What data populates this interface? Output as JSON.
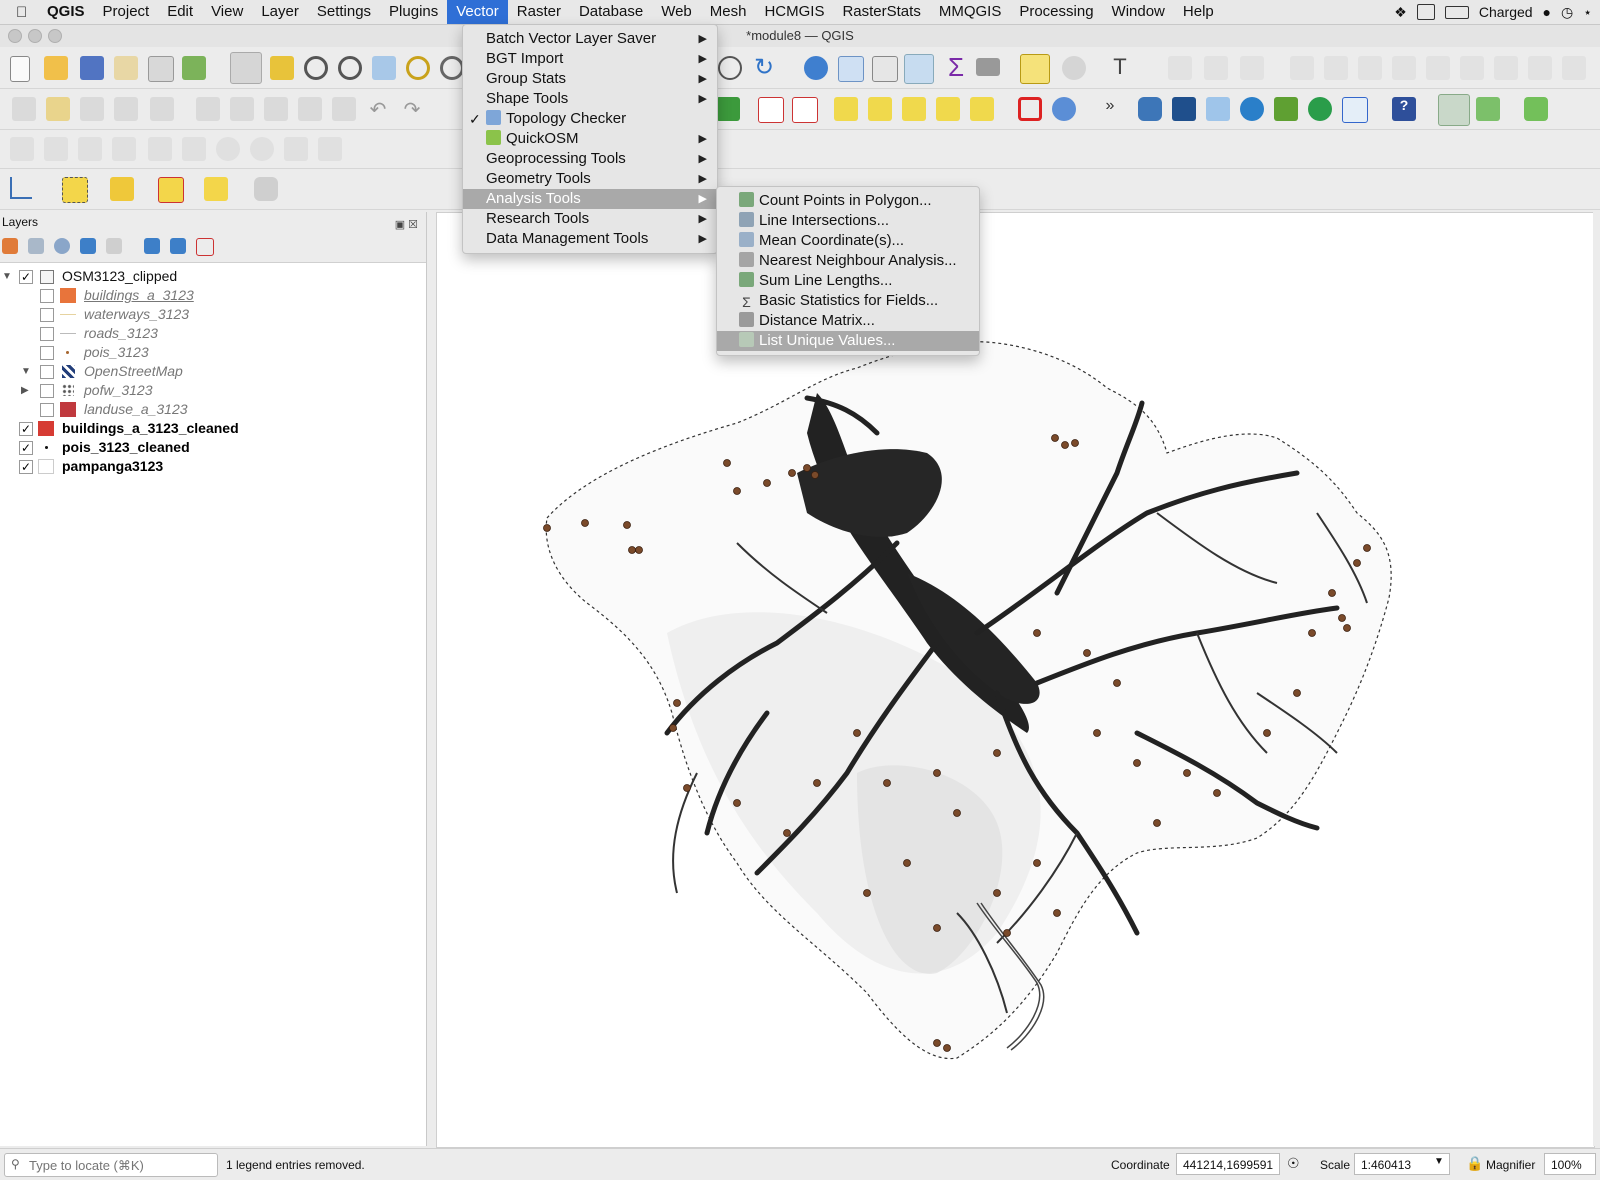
{
  "menubar": {
    "app": "QGIS",
    "items": [
      "Project",
      "Edit",
      "View",
      "Layer",
      "Settings",
      "Plugins",
      "Vector",
      "Raster",
      "Database",
      "Web",
      "Mesh",
      "HCMGIS",
      "RasterStats",
      "MMQGIS",
      "Processing",
      "Window",
      "Help"
    ],
    "active": "Vector",
    "battery": "Charged"
  },
  "window": {
    "title": "*module8 — QGIS"
  },
  "layers_panel": {
    "title": "Layers",
    "tree": [
      {
        "label": "OSM3123_clipped",
        "checked": true,
        "group": true,
        "expanded": true,
        "style": "normal"
      },
      {
        "label": "buildings_a_3123",
        "checked": false,
        "style": "off",
        "swatch": "#e8743b"
      },
      {
        "label": "waterways_3123",
        "checked": false,
        "style": "off",
        "swatch": "line-light"
      },
      {
        "label": "roads_3123",
        "checked": false,
        "style": "off",
        "swatch": "line-gray"
      },
      {
        "label": "pois_3123",
        "checked": false,
        "style": "off",
        "swatch": "dot"
      },
      {
        "label": "OpenStreetMap",
        "checked": false,
        "style": "off",
        "swatch": "osm",
        "expanded": true
      },
      {
        "label": "pofw_3123",
        "checked": false,
        "style": "off",
        "swatch": "points",
        "collapsed": true
      },
      {
        "label": "landuse_a_3123",
        "checked": false,
        "style": "off",
        "swatch": "#c0393e"
      },
      {
        "label": "buildings_a_3123_cleaned",
        "checked": true,
        "style": "on",
        "swatch": "#d63b33"
      },
      {
        "label": "pois_3123_cleaned",
        "checked": true,
        "style": "on",
        "swatch": "dot-black"
      },
      {
        "label": "pampanga3123",
        "checked": true,
        "style": "on",
        "swatch": "empty"
      }
    ]
  },
  "vector_menu": {
    "items": [
      {
        "label": "Batch Vector Layer Saver",
        "submenu": true
      },
      {
        "label": "BGT Import",
        "submenu": true
      },
      {
        "label": "Group Stats",
        "submenu": true
      },
      {
        "label": "Shape Tools",
        "submenu": true
      },
      {
        "label": "Topology Checker",
        "checked": true,
        "icon": true
      },
      {
        "label": "QuickOSM",
        "submenu": true,
        "icon": true
      },
      {
        "label": "Geoprocessing Tools",
        "submenu": true
      },
      {
        "label": "Geometry Tools",
        "submenu": true
      },
      {
        "label": "Analysis Tools",
        "submenu": true,
        "highlighted": true
      },
      {
        "label": "Research Tools",
        "submenu": true
      },
      {
        "label": "Data Management Tools",
        "submenu": true
      }
    ]
  },
  "analysis_submenu": {
    "items": [
      {
        "label": "Count Points in Polygon...",
        "icon": "count-points-icon"
      },
      {
        "label": "Line Intersections...",
        "icon": "line-intersections-icon"
      },
      {
        "label": "Mean Coordinate(s)...",
        "icon": "mean-coordinates-icon"
      },
      {
        "label": "Nearest Neighbour Analysis...",
        "icon": "nearest-neighbour-icon"
      },
      {
        "label": "Sum Line Lengths...",
        "icon": "sum-line-lengths-icon"
      },
      {
        "label": "Basic Statistics for Fields...",
        "icon": "sigma-icon"
      },
      {
        "label": "Distance Matrix...",
        "icon": "distance-matrix-icon"
      },
      {
        "label": "List Unique Values...",
        "icon": "list-unique-icon",
        "highlighted": true
      }
    ]
  },
  "status": {
    "locator_placeholder": "Type to locate (⌘K)",
    "message": "1 legend entries removed.",
    "coordinate_label": "Coordinate",
    "coordinate": "441214,1699591",
    "scale_label": "Scale",
    "scale": "1:460413",
    "magnifier_label": "Magnifier",
    "magnifier": "100%"
  }
}
